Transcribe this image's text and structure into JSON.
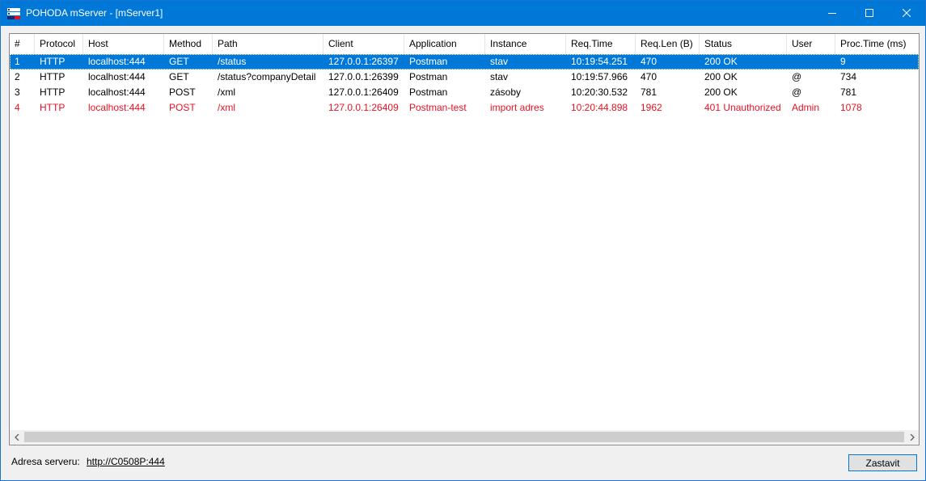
{
  "window": {
    "title": "POHODA mServer - [mServer1]"
  },
  "table": {
    "columns": [
      "#",
      "Protocol",
      "Host",
      "Method",
      "Path",
      "Client",
      "Application",
      "Instance",
      "Req.Time",
      "Req.Len (B)",
      "Status",
      "User",
      "Proc.Time (ms)"
    ],
    "rows": [
      {
        "state": "selected",
        "cells": [
          "1",
          "HTTP",
          "localhost:444",
          "GET",
          "/status",
          "127.0.0.1:26397",
          "Postman",
          "stav",
          "10:19:54.251",
          "470",
          "200 OK",
          "",
          "9"
        ]
      },
      {
        "state": "normal",
        "cells": [
          "2",
          "HTTP",
          "localhost:444",
          "GET",
          "/status?companyDetail",
          "127.0.0.1:26399",
          "Postman",
          "stav",
          "10:19:57.966",
          "470",
          "200 OK",
          "@",
          "734"
        ]
      },
      {
        "state": "normal",
        "cells": [
          "3",
          "HTTP",
          "localhost:444",
          "POST",
          "/xml",
          "127.0.0.1:26409",
          "Postman",
          "zásoby",
          "10:20:30.532",
          "781",
          "200 OK",
          "@",
          "781"
        ]
      },
      {
        "state": "error",
        "cells": [
          "4",
          "HTTP",
          "localhost:444",
          "POST",
          "/xml",
          "127.0.0.1:26409",
          "Postman-test",
          "import adres",
          "10:20:44.898",
          "1962",
          "401 Unauthorized",
          "Admin",
          "1078"
        ]
      }
    ]
  },
  "footer": {
    "address_label": "Adresa serveru:",
    "address_link": "http://C0508P:444",
    "stop_label": "Zastavit"
  },
  "colors": {
    "titlebar": "#0078d7",
    "selection": "#0078d7",
    "error_text": "#e81123"
  },
  "icons": {
    "app": "server-icon",
    "minimize": "minimize-icon",
    "maximize": "maximize-icon",
    "close": "close-icon",
    "scroll_left": "arrow-left-icon",
    "scroll_right": "arrow-right-icon"
  }
}
